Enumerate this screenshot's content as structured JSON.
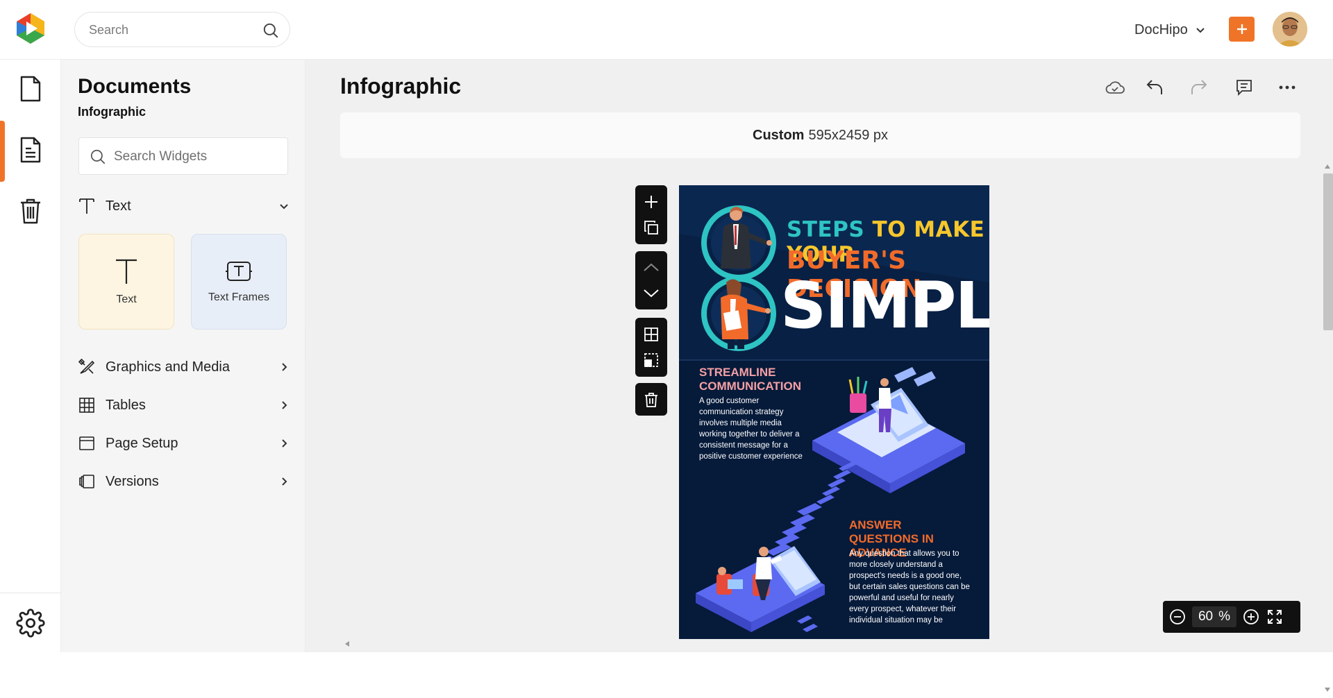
{
  "topbar": {
    "search_placeholder": "Search",
    "account_label": "DocHipo",
    "brand_colors": {
      "accent": "#f07428"
    }
  },
  "rail": {
    "items": [
      {
        "icon": "document-icon"
      },
      {
        "icon": "document-list-icon",
        "active": true
      },
      {
        "icon": "trash-icon"
      }
    ],
    "bottom_icon": "settings-gear-icon"
  },
  "panel": {
    "title": "Documents",
    "subtitle": "Infographic",
    "widget_search_placeholder": "Search Widgets",
    "text_section": {
      "label": "Text",
      "expanded": true
    },
    "cards": [
      {
        "label": "Text"
      },
      {
        "label": "Text Frames"
      }
    ],
    "sections": [
      {
        "label": "Graphics and Media"
      },
      {
        "label": "Tables"
      },
      {
        "label": "Page Setup"
      },
      {
        "label": "Versions"
      }
    ]
  },
  "main": {
    "title": "Infographic",
    "size_bar": {
      "prefix": "Custom",
      "dimensions": "595x2459 px"
    },
    "zoom": {
      "value": "60",
      "unit": "%"
    }
  },
  "canvas": {
    "steps": "STEPS",
    "to_make_your": " TO MAKE YOUR",
    "buyers_decision": "BUYER'S DECISION",
    "simple": "SIMPLE",
    "section1_heading": "STREAMLINE COMMUNICATION",
    "section1_body": "A good customer communication strategy involves multiple media working together to deliver a consistent message for a positive customer experience",
    "section2_heading": "ANSWER QUESTIONS IN ADVANCE",
    "section2_body": "Any question that allows you to more closely understand a prospect's needs is a good one, but certain sales questions can be powerful and useful for nearly every prospect, whatever their individual situation may be",
    "colors": {
      "bg": "#061a3a",
      "teal": "#2ec4c4",
      "yellow": "#f6c72c",
      "orange": "#f26b2a",
      "pink": "#f4a0a4"
    }
  }
}
